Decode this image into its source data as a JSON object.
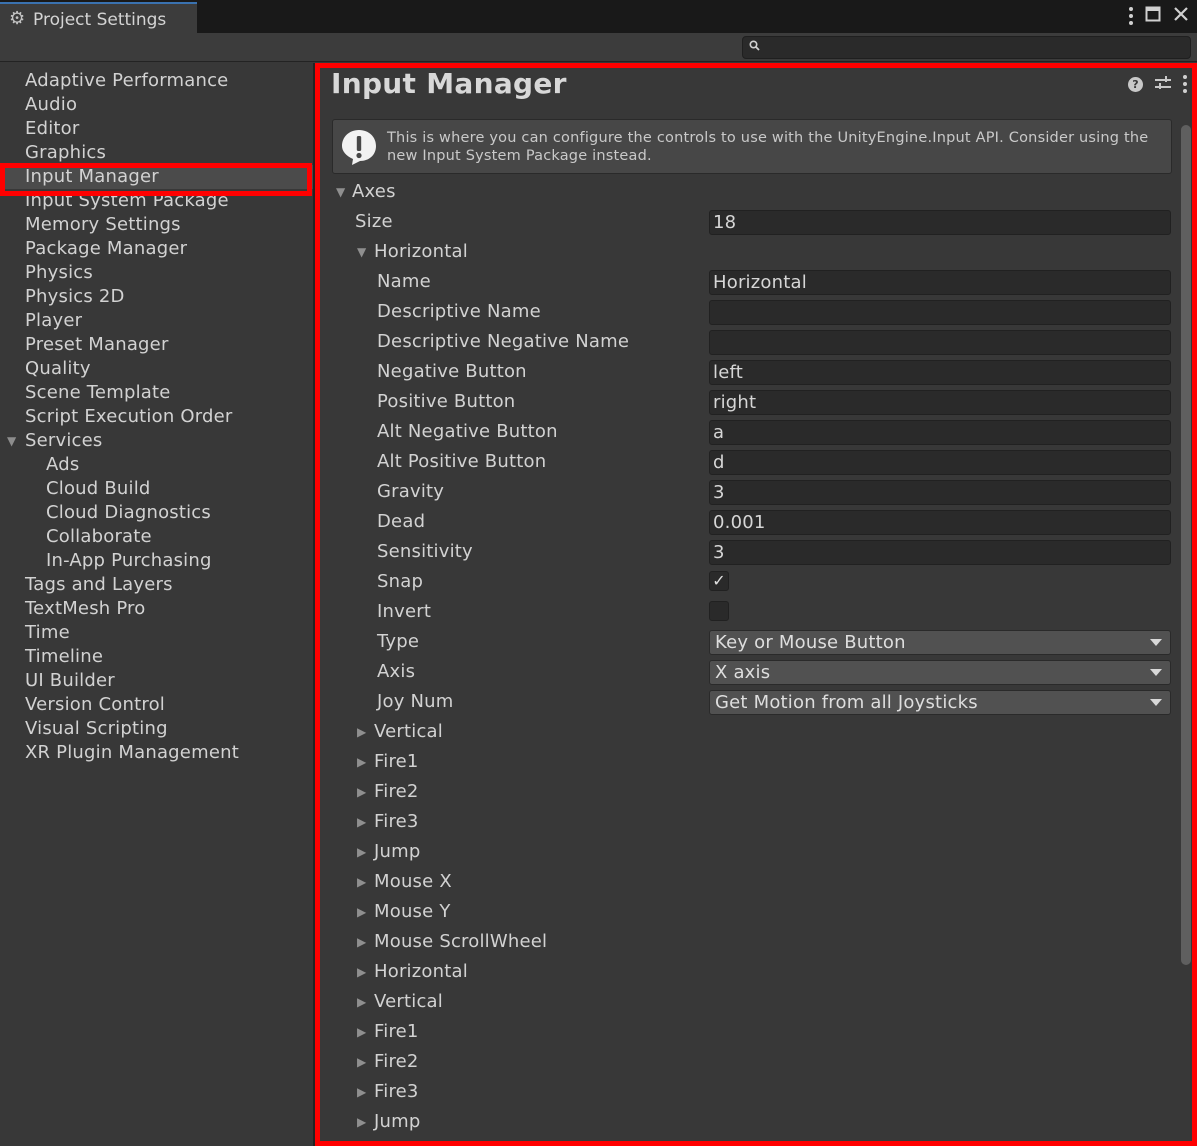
{
  "window": {
    "tab_title": "Project Settings",
    "gear_icon": "gear-icon",
    "controls": [
      "more-options-icon",
      "maximize-icon",
      "close-icon"
    ]
  },
  "search": {
    "placeholder": "",
    "value": ""
  },
  "sidebar": {
    "items": [
      {
        "label": "Adaptive Performance",
        "indent": 0
      },
      {
        "label": "Audio",
        "indent": 0
      },
      {
        "label": "Editor",
        "indent": 0
      },
      {
        "label": "Graphics",
        "indent": 0
      },
      {
        "label": "Input Manager",
        "indent": 0,
        "selected": true
      },
      {
        "label": "Input System Package",
        "indent": 0
      },
      {
        "label": "Memory Settings",
        "indent": 0
      },
      {
        "label": "Package Manager",
        "indent": 0
      },
      {
        "label": "Physics",
        "indent": 0
      },
      {
        "label": "Physics 2D",
        "indent": 0
      },
      {
        "label": "Player",
        "indent": 0
      },
      {
        "label": "Preset Manager",
        "indent": 0
      },
      {
        "label": "Quality",
        "indent": 0
      },
      {
        "label": "Scene Template",
        "indent": 0
      },
      {
        "label": "Script Execution Order",
        "indent": 0
      },
      {
        "label": "Services",
        "indent": 0,
        "expanded": true
      },
      {
        "label": "Ads",
        "indent": 1
      },
      {
        "label": "Cloud Build",
        "indent": 1
      },
      {
        "label": "Cloud Diagnostics",
        "indent": 1
      },
      {
        "label": "Collaborate",
        "indent": 1
      },
      {
        "label": "In-App Purchasing",
        "indent": 1
      },
      {
        "label": "Tags and Layers",
        "indent": 0
      },
      {
        "label": "TextMesh Pro",
        "indent": 0
      },
      {
        "label": "Time",
        "indent": 0
      },
      {
        "label": "Timeline",
        "indent": 0
      },
      {
        "label": "UI Builder",
        "indent": 0
      },
      {
        "label": "Version Control",
        "indent": 0
      },
      {
        "label": "Visual Scripting",
        "indent": 0
      },
      {
        "label": "XR Plugin Management",
        "indent": 0
      }
    ]
  },
  "main": {
    "title": "Input Manager",
    "header_icons": [
      "help-icon",
      "presets-icon",
      "more-options-icon"
    ],
    "info": "This is where you can configure the controls to use with the UnityEngine.Input API. Consider using the new Input System Package instead.",
    "axes_label": "Axes",
    "size_label": "Size",
    "size_value": "18",
    "horizontal_label": "Horizontal",
    "fields": [
      {
        "label": "Name",
        "kind": "text",
        "value": "Horizontal"
      },
      {
        "label": "Descriptive Name",
        "kind": "text",
        "value": ""
      },
      {
        "label": "Descriptive Negative Name",
        "kind": "text",
        "value": ""
      },
      {
        "label": "Negative Button",
        "kind": "text",
        "value": "left"
      },
      {
        "label": "Positive Button",
        "kind": "text",
        "value": "right"
      },
      {
        "label": "Alt Negative Button",
        "kind": "text",
        "value": "a"
      },
      {
        "label": "Alt Positive Button",
        "kind": "text",
        "value": "d"
      },
      {
        "label": "Gravity",
        "kind": "text",
        "value": "3"
      },
      {
        "label": "Dead",
        "kind": "text",
        "value": "0.001"
      },
      {
        "label": "Sensitivity",
        "kind": "text",
        "value": "3"
      },
      {
        "label": "Snap",
        "kind": "checkbox",
        "checked": true
      },
      {
        "label": "Invert",
        "kind": "checkbox",
        "checked": false
      },
      {
        "label": "Type",
        "kind": "select",
        "value": "Key or Mouse Button"
      },
      {
        "label": "Axis",
        "kind": "select",
        "value": "X axis"
      },
      {
        "label": "Joy Num",
        "kind": "select",
        "value": "Get Motion from all Joysticks"
      }
    ],
    "collapsed_axes": [
      "Vertical",
      "Fire1",
      "Fire2",
      "Fire3",
      "Jump",
      "Mouse X",
      "Mouse Y",
      "Mouse ScrollWheel",
      "Horizontal",
      "Vertical",
      "Fire1",
      "Fire2",
      "Fire3",
      "Jump"
    ]
  },
  "colors": {
    "highlight_outline": "#ff0000",
    "background": "#383838",
    "field_bg": "#2a2a2a"
  }
}
